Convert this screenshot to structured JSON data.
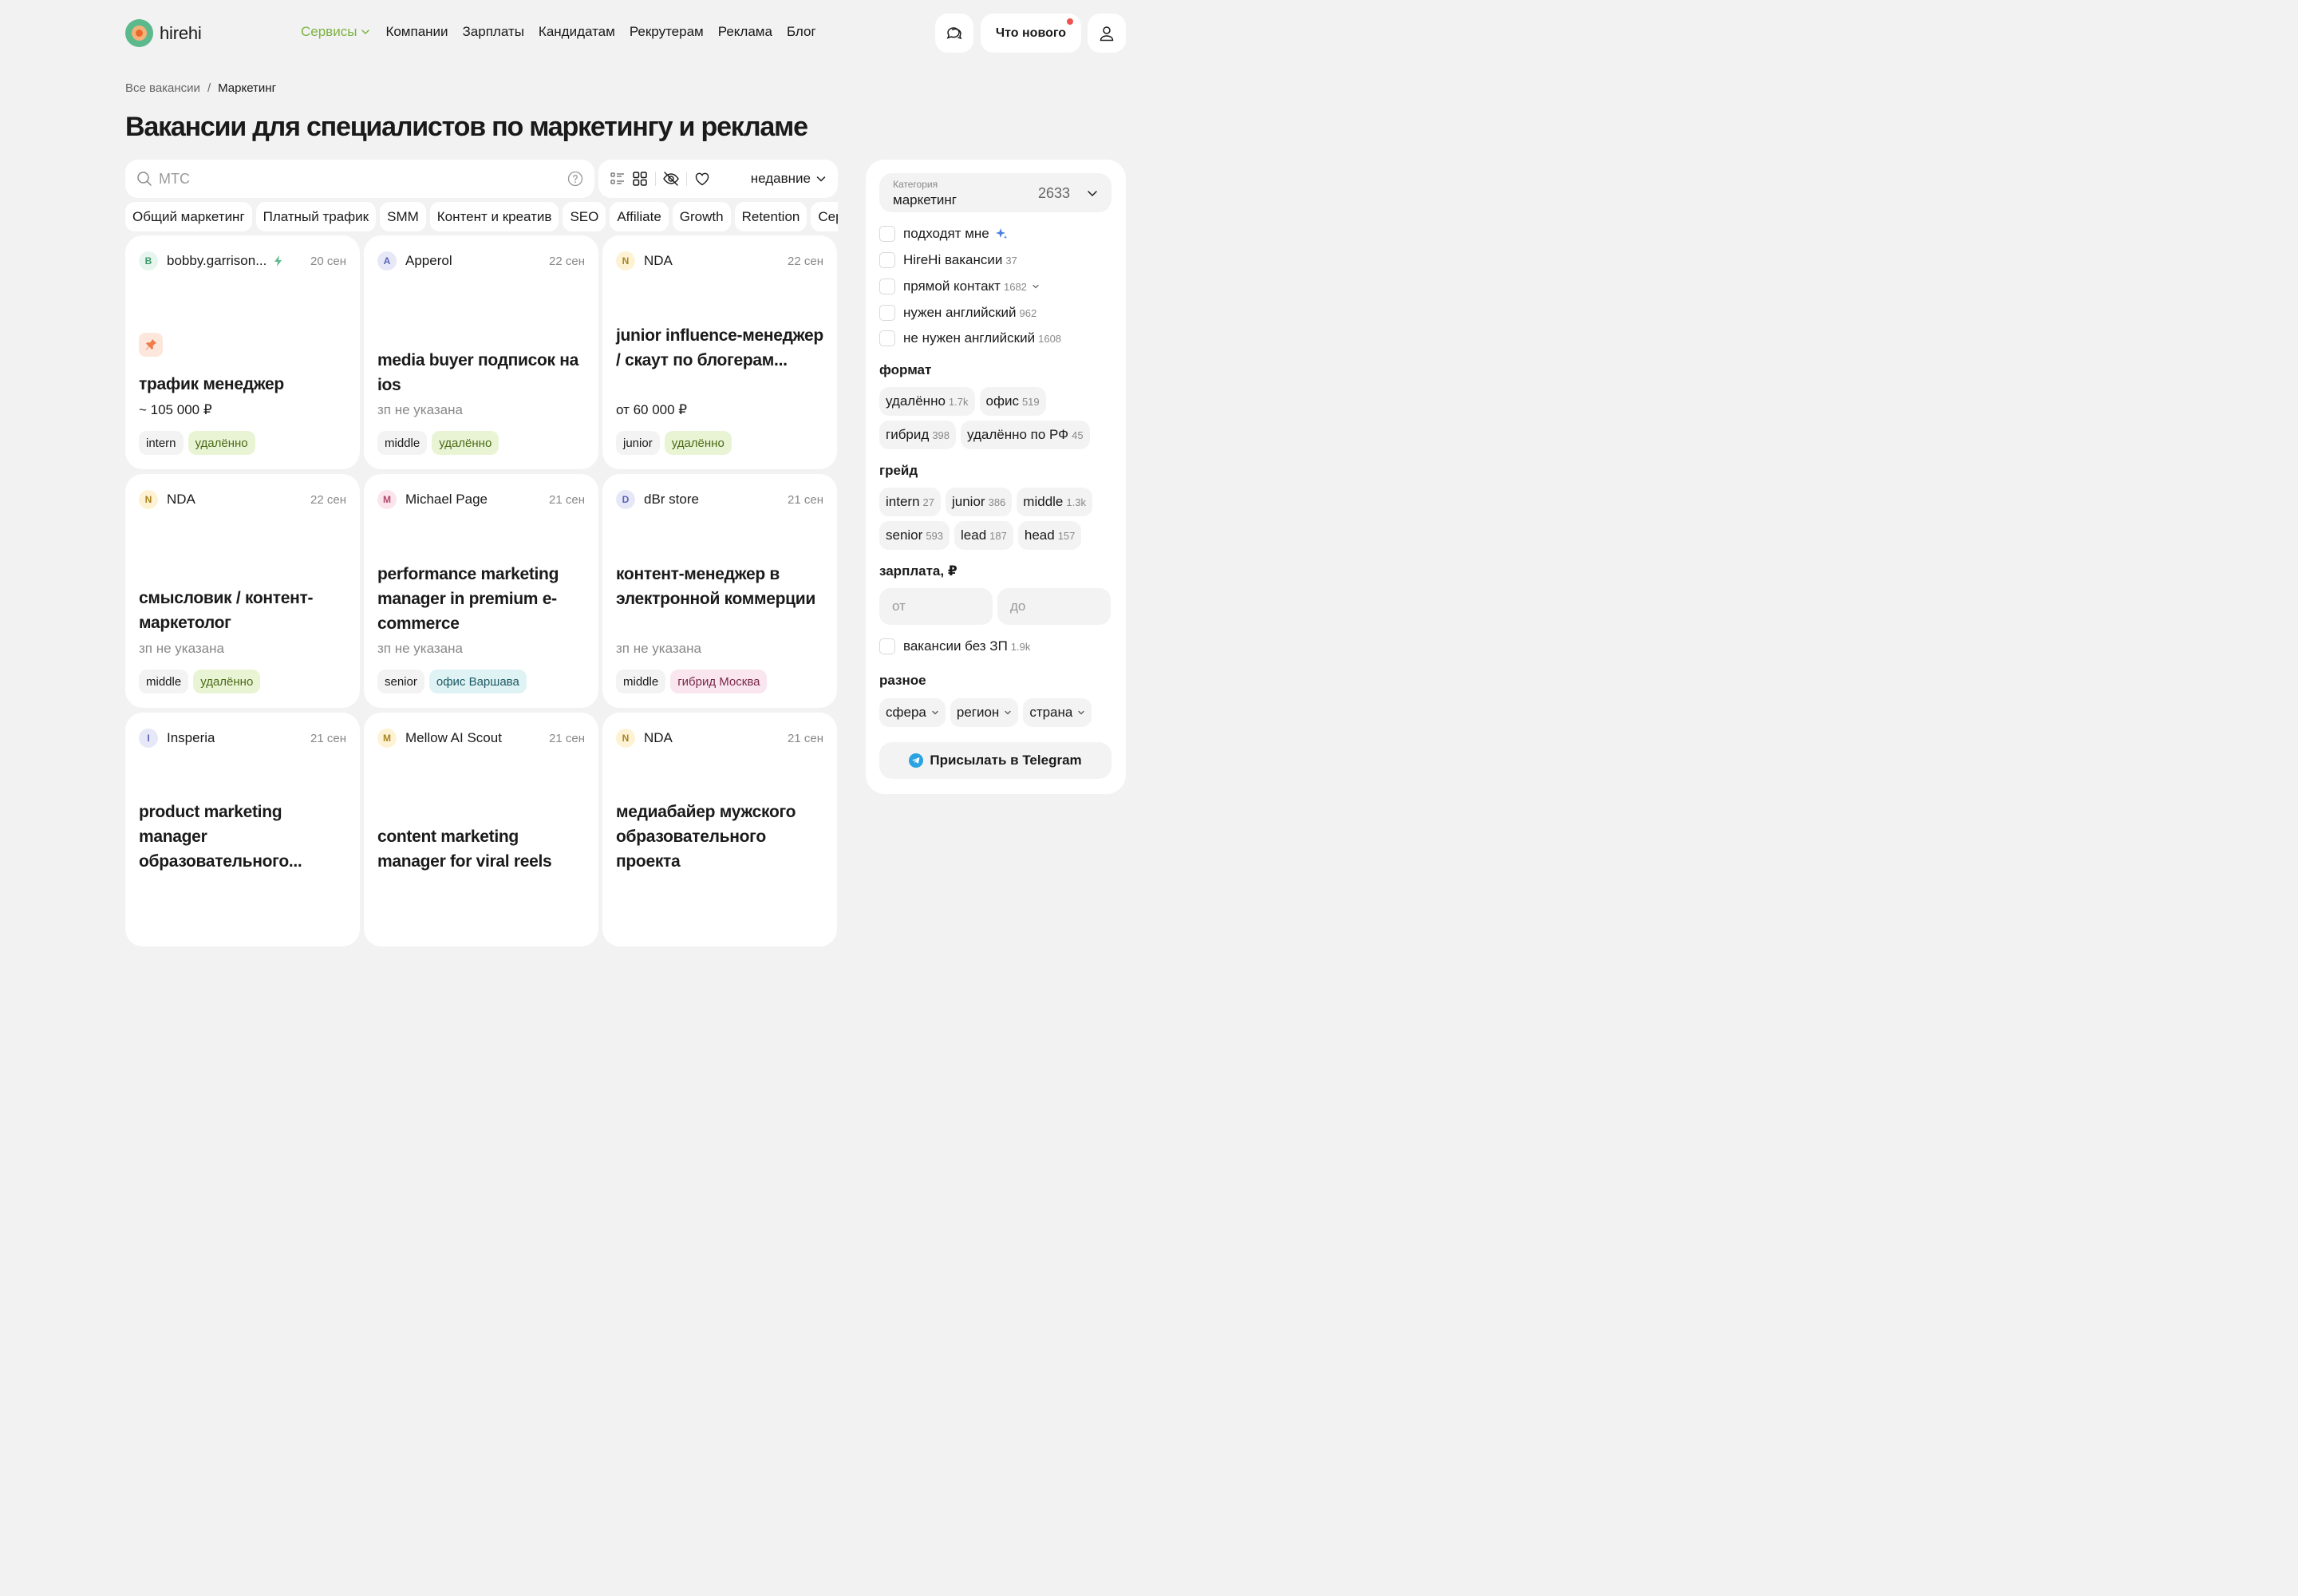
{
  "header": {
    "logo_text": "hirehi",
    "nav": [
      {
        "label": "Сервисы"
      },
      {
        "label": "Компании"
      },
      {
        "label": "Зарплаты"
      },
      {
        "label": "Кандидатам"
      },
      {
        "label": "Рекрутерам"
      },
      {
        "label": "Реклама"
      },
      {
        "label": "Блог"
      }
    ],
    "whats_new_label": "Что нового"
  },
  "breadcrumb": {
    "root": "Все вакансии",
    "separator": "/",
    "current": "Маркетинг"
  },
  "page_title": "Вакансии для специалистов по маркетингу и рекламе",
  "search": {
    "placeholder": "МТС"
  },
  "toolbar": {
    "sort_label": "недавние"
  },
  "chips": [
    "Общий маркетинг",
    "Платный трафик",
    "SMM",
    "Контент и креатив",
    "SEO",
    "Affiliate",
    "Growth",
    "Retention",
    "Сервис"
  ],
  "cards": [
    {
      "initial": "B",
      "company": "bobby.garrison...",
      "date": "20 сен",
      "title": "трафик менеджер",
      "salary": "~ 105 000 ₽",
      "grade": "intern",
      "format": "удалённо"
    },
    {
      "initial": "A",
      "company": "Apperol",
      "date": "22 сен",
      "title": "media buyer подписок на ios",
      "salary": "зп не указана",
      "grade": "middle",
      "format": "удалённо"
    },
    {
      "initial": "N",
      "company": "NDA",
      "date": "22 сен",
      "title": "junior influence-менеджер / скаут по блогерам...",
      "salary": "от 60 000 ₽",
      "grade": "junior",
      "format": "удалённо"
    },
    {
      "initial": "N",
      "company": "NDA",
      "date": "22 сен",
      "title": "смысловик / контент-маркетолог",
      "salary": "зп не указана",
      "grade": "middle",
      "format": "удалённо"
    },
    {
      "initial": "M",
      "company": "Michael Page",
      "date": "21 сен",
      "title": "performance marketing manager in premium e-commerce",
      "salary": "зп не указана",
      "grade": "senior",
      "format": "офис Варшава"
    },
    {
      "initial": "D",
      "company": "dBr store",
      "date": "21 сен",
      "title": "контент-менеджер в электронной коммерции",
      "salary": "зп не указана",
      "grade": "middle",
      "format": "гибрид Москва"
    },
    {
      "initial": "I",
      "company": "Insperia",
      "date": "21 сен",
      "title": "product marketing manager образовательного..."
    },
    {
      "initial": "M",
      "company": "Mellow AI Scout",
      "date": "21 сен",
      "title": "content marketing manager for viral reels"
    },
    {
      "initial": "N",
      "company": "NDA",
      "date": "21 сен",
      "title": "медиабайер мужского образовательного проекта"
    }
  ],
  "sidebar": {
    "category": {
      "label": "Категория",
      "value": "маркетинг",
      "count": "2633"
    },
    "checks": [
      {
        "label": "подходят мне",
        "count": ""
      },
      {
        "label": "HireHi вакансии",
        "count": "37"
      },
      {
        "label": "прямой контакт",
        "count": "1682"
      },
      {
        "label": "нужен английский",
        "count": "962"
      },
      {
        "label": "не нужен английский",
        "count": "1608"
      }
    ],
    "format_label": "формат",
    "formats": [
      {
        "label": "удалённо",
        "count": "1.7k"
      },
      {
        "label": "офис",
        "count": "519"
      },
      {
        "label": "гибрид",
        "count": "398"
      },
      {
        "label": "удалённо по РФ",
        "count": "45"
      }
    ],
    "grade_label": "грейд",
    "grades": [
      {
        "label": "intern",
        "count": "27"
      },
      {
        "label": "junior",
        "count": "386"
      },
      {
        "label": "middle",
        "count": "1.3k"
      },
      {
        "label": "senior",
        "count": "593"
      },
      {
        "label": "lead",
        "count": "187"
      },
      {
        "label": "head",
        "count": "157"
      }
    ],
    "salary_label": "зарплата, ₽",
    "salary_from_placeholder": "от",
    "salary_to_placeholder": "до",
    "no_salary": {
      "label": "вакансии без ЗП",
      "count": "1.9k"
    },
    "misc_label": "разное",
    "misc": [
      "сфера",
      "регион",
      "страна"
    ],
    "telegram_label": "Присылать в Telegram"
  },
  "colors": {
    "accent_green": "#7cb342",
    "remote_tag_bg": "#e9f4d4",
    "office_tag_bg": "#dff2f4",
    "hybrid_tag_bg": "#f9e6ee",
    "telegram_blue": "#2aa3e2"
  }
}
